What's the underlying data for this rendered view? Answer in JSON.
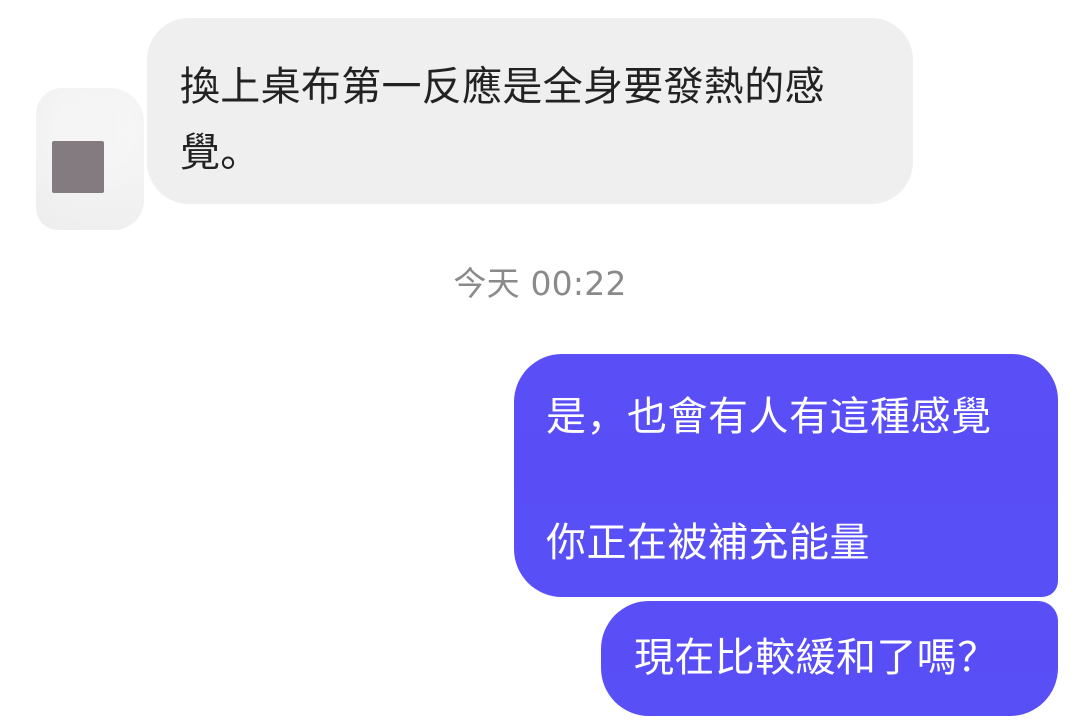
{
  "chat": {
    "incoming_message": "換上桌布第一反應是全身要發熱的感覺。",
    "timestamp": "今天 00:22",
    "outgoing_messages": [
      {
        "line1": "是，也會有人有這種感覺",
        "line2": "你正在被補充能量"
      },
      {
        "text": "現在比較緩和了嗎？"
      }
    ]
  },
  "colors": {
    "incoming_bubble": "#efefef",
    "outgoing_bubble": "#584ff6",
    "timestamp_text": "#8a8a8a"
  }
}
